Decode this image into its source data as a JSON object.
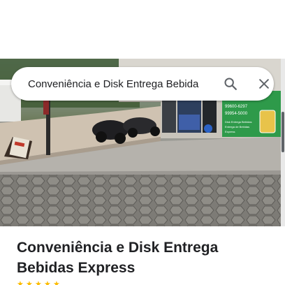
{
  "search": {
    "query": "Conveniência e Disk Entrega Bebida",
    "search_icon": "search-icon",
    "close_icon": "close-icon"
  },
  "photo": {
    "sign_text_1": "99600-6297",
    "sign_text_2": "99954-5000",
    "sign_text_3": "Disk Entrega Bebidas",
    "sign_text_4": "Entrega de Bebidas",
    "sign_text_5": "Express",
    "sign_text_6": "Express"
  },
  "place": {
    "title": "Conveniência e Disk Entrega Bebidas Express",
    "rating_icons": [
      "star-icon",
      "star-icon",
      "star-icon",
      "star-icon",
      "star-icon"
    ]
  },
  "colors": {
    "accent_green": "#2e9a4a",
    "text_primary": "#202124",
    "icon_gray": "#5f6368",
    "star": "#fbbc04"
  }
}
